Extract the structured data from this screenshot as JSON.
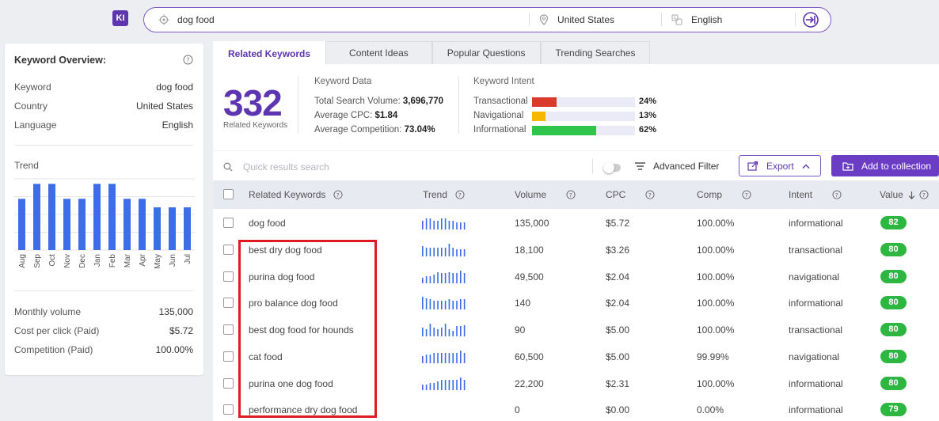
{
  "app": {
    "logo": "KI"
  },
  "search": {
    "query": "dog food",
    "country": "United States",
    "language": "English"
  },
  "overview": {
    "title": "Keyword Overview:",
    "rows": [
      {
        "label": "Keyword",
        "value": "dog food"
      },
      {
        "label": "Country",
        "value": "United States"
      },
      {
        "label": "Language",
        "value": "English"
      }
    ],
    "trend_title": "Trend",
    "metrics": [
      {
        "label": "Monthly volume",
        "value": "135,000"
      },
      {
        "label": "Cost per click (Paid)",
        "value": "$5.72"
      },
      {
        "label": "Competition (Paid)",
        "value": "100.00%"
      }
    ]
  },
  "chart_data": {
    "type": "bar",
    "title": "Trend",
    "categories": [
      "Aug",
      "Sep",
      "Oct",
      "Nov",
      "Dec",
      "Jan",
      "Feb",
      "Mar",
      "Apr",
      "May",
      "Jun",
      "Jul"
    ],
    "values": [
      0.72,
      0.93,
      0.93,
      0.72,
      0.72,
      0.93,
      0.93,
      0.72,
      0.72,
      0.6,
      0.6,
      0.6
    ],
    "ylim": [
      0,
      1
    ],
    "grid": true
  },
  "tabs": [
    "Related Keywords",
    "Content Ideas",
    "Popular Questions",
    "Trending Searches"
  ],
  "summary": {
    "count": "332",
    "count_label": "Related Keywords",
    "data_title": "Keyword Data",
    "data": [
      {
        "label": "Total Search Volume:",
        "value": "3,696,770"
      },
      {
        "label": "Average CPC:",
        "value": "$1.84"
      },
      {
        "label": "Average Competition:",
        "value": "73.04%"
      }
    ],
    "intent_title": "Keyword Intent",
    "intent": [
      {
        "label": "Transactional",
        "pct": "24%",
        "fraction": 0.24,
        "color": "#d93a2b"
      },
      {
        "label": "Navigational",
        "pct": "13%",
        "fraction": 0.13,
        "color": "#f5b700"
      },
      {
        "label": "Informational",
        "pct": "62%",
        "fraction": 0.62,
        "color": "#2ec54a"
      }
    ]
  },
  "toolbar": {
    "search_placeholder": "Quick results search",
    "advanced_filter": "Advanced Filter",
    "export": "Export",
    "add_collection": "Add to collection"
  },
  "table": {
    "headers": {
      "keyword": "Related Keywords",
      "trend": "Trend",
      "volume": "Volume",
      "cpc": "CPC",
      "comp": "Comp",
      "intent": "Intent",
      "value": "Value"
    },
    "rows": [
      {
        "keyword": "dog food",
        "volume": "135,000",
        "cpc": "$5.72",
        "comp": "100.00%",
        "intent": "informational",
        "value": "82",
        "trend": [
          0.6,
          0.8,
          0.8,
          0.6,
          0.6,
          0.8,
          0.8,
          0.6,
          0.6,
          0.5,
          0.5,
          0.5
        ]
      },
      {
        "keyword": "best dry dog food",
        "volume": "18,100",
        "cpc": "$3.26",
        "comp": "100.00%",
        "intent": "transactional",
        "value": "80",
        "trend": [
          0.7,
          0.6,
          0.6,
          0.6,
          0.6,
          0.6,
          0.6,
          0.9,
          0.6,
          0.5,
          0.5,
          0.5
        ]
      },
      {
        "keyword": "purina dog food",
        "volume": "49,500",
        "cpc": "$2.04",
        "comp": "100.00%",
        "intent": "navigational",
        "value": "80",
        "trend": [
          0.4,
          0.5,
          0.5,
          0.6,
          0.8,
          0.7,
          0.7,
          0.8,
          0.7,
          0.7,
          0.9,
          0.7
        ]
      },
      {
        "keyword": "pro balance dog food",
        "volume": "140",
        "cpc": "$2.04",
        "comp": "100.00%",
        "intent": "informational",
        "value": "80",
        "trend": [
          0.9,
          0.8,
          0.7,
          0.6,
          0.6,
          0.6,
          0.6,
          0.7,
          0.6,
          0.6,
          0.7,
          0.7
        ]
      },
      {
        "keyword": "best dog food for hounds",
        "volume": "90",
        "cpc": "$5.00",
        "comp": "100.00%",
        "intent": "transactional",
        "value": "80",
        "trend": [
          0.6,
          0.5,
          0.9,
          0.6,
          0.5,
          0.6,
          0.9,
          0.5,
          0.4,
          0.7,
          0.7,
          0.8
        ]
      },
      {
        "keyword": "cat food",
        "volume": "60,500",
        "cpc": "$5.00",
        "comp": "99.99%",
        "intent": "navigational",
        "value": "80",
        "trend": [
          0.5,
          0.6,
          0.6,
          0.7,
          0.7,
          0.7,
          0.7,
          0.7,
          0.7,
          0.7,
          0.9,
          0.7
        ]
      },
      {
        "keyword": "purina one dog food",
        "volume": "22,200",
        "cpc": "$2.31",
        "comp": "100.00%",
        "intent": "informational",
        "value": "80",
        "trend": [
          0.4,
          0.4,
          0.5,
          0.5,
          0.6,
          0.7,
          0.7,
          0.7,
          0.7,
          0.7,
          0.9,
          0.7
        ]
      },
      {
        "keyword": "performance dry dog food",
        "volume": "0",
        "cpc": "$0.00",
        "comp": "0.00%",
        "intent": "informational",
        "value": "79",
        "trend": []
      }
    ]
  }
}
